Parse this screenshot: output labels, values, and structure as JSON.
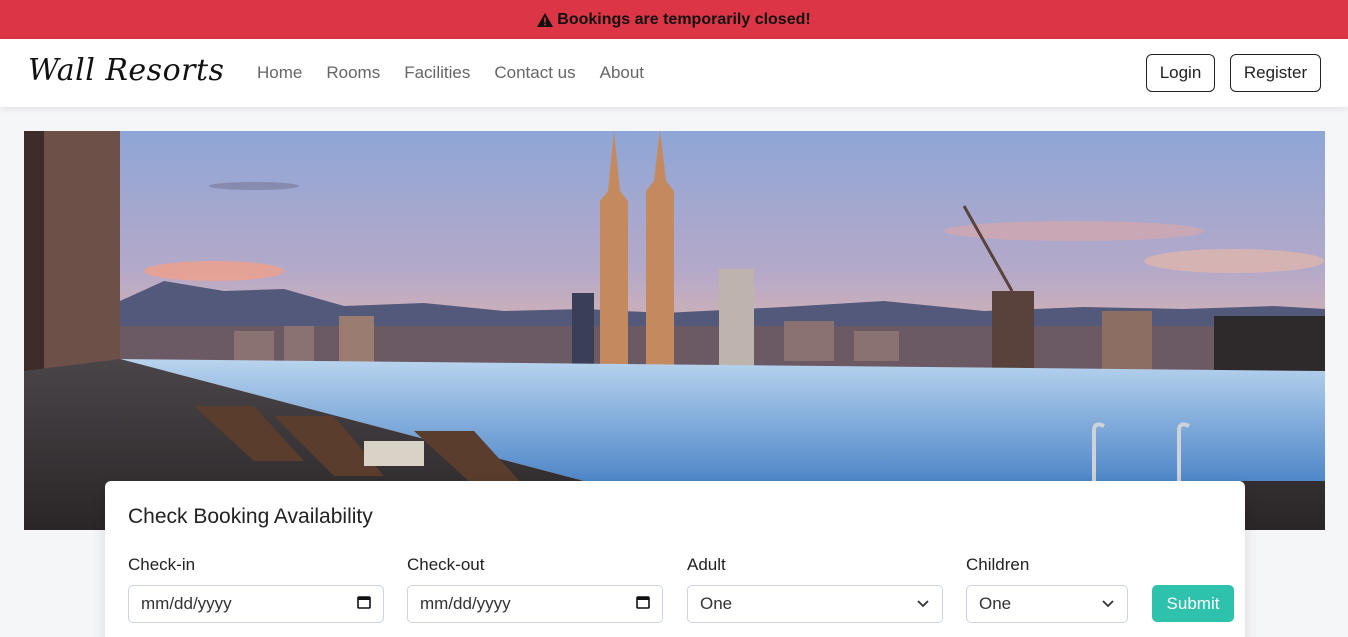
{
  "alert": {
    "icon": "warning-triangle-icon",
    "text": "Bookings are temporarily closed!",
    "color": "#dc3545"
  },
  "navbar": {
    "brand": "Wall Resorts",
    "links": [
      "Home",
      "Rooms",
      "Facilities",
      "Contact us",
      "About"
    ],
    "login_label": "Login",
    "register_label": "Register"
  },
  "hero": {
    "image": "city-skyline-infinity-pool"
  },
  "booking": {
    "title": "Check Booking Availability",
    "checkin_label": "Check-in",
    "checkin_placeholder": "mm/dd/yyyy",
    "checkout_label": "Check-out",
    "checkout_placeholder": "mm/dd/yyyy",
    "adult_label": "Adult",
    "adult_value": "One",
    "children_label": "Children",
    "children_value": "One",
    "submit_label": "Submit",
    "accent": "#2ec1ac"
  }
}
